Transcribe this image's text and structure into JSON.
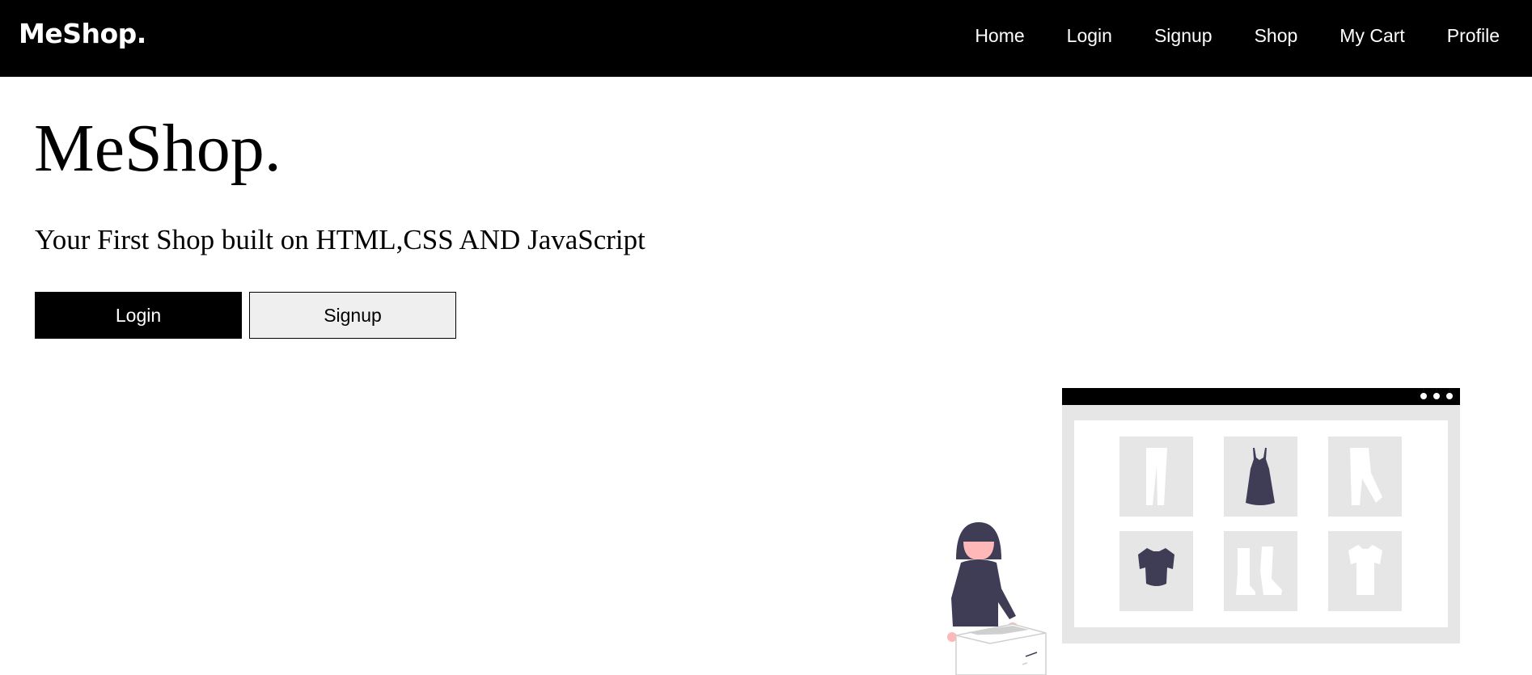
{
  "navbar": {
    "brand": "MeShop.",
    "links": [
      {
        "label": "Home"
      },
      {
        "label": "Login"
      },
      {
        "label": "Signup"
      },
      {
        "label": "Shop"
      },
      {
        "label": "My Cart"
      },
      {
        "label": "Profile"
      }
    ]
  },
  "hero": {
    "title": "MeShop.",
    "tagline": "Your First Shop built on HTML,CSS AND JavaScript",
    "login_button": "Login",
    "signup_button": "Signup"
  },
  "colors": {
    "navbar_bg": "#000000",
    "primary_button_bg": "#000000",
    "secondary_button_bg": "#efefef",
    "illustration_gray": "#e6e6e6",
    "illustration_navy": "#3f3d56",
    "illustration_skin": "#ffb8b8"
  },
  "illustration": {
    "icons": [
      "pants-icon",
      "dress-icon",
      "pants-icon",
      "crop-top-icon",
      "boots-icon",
      "tshirt-icon"
    ]
  }
}
